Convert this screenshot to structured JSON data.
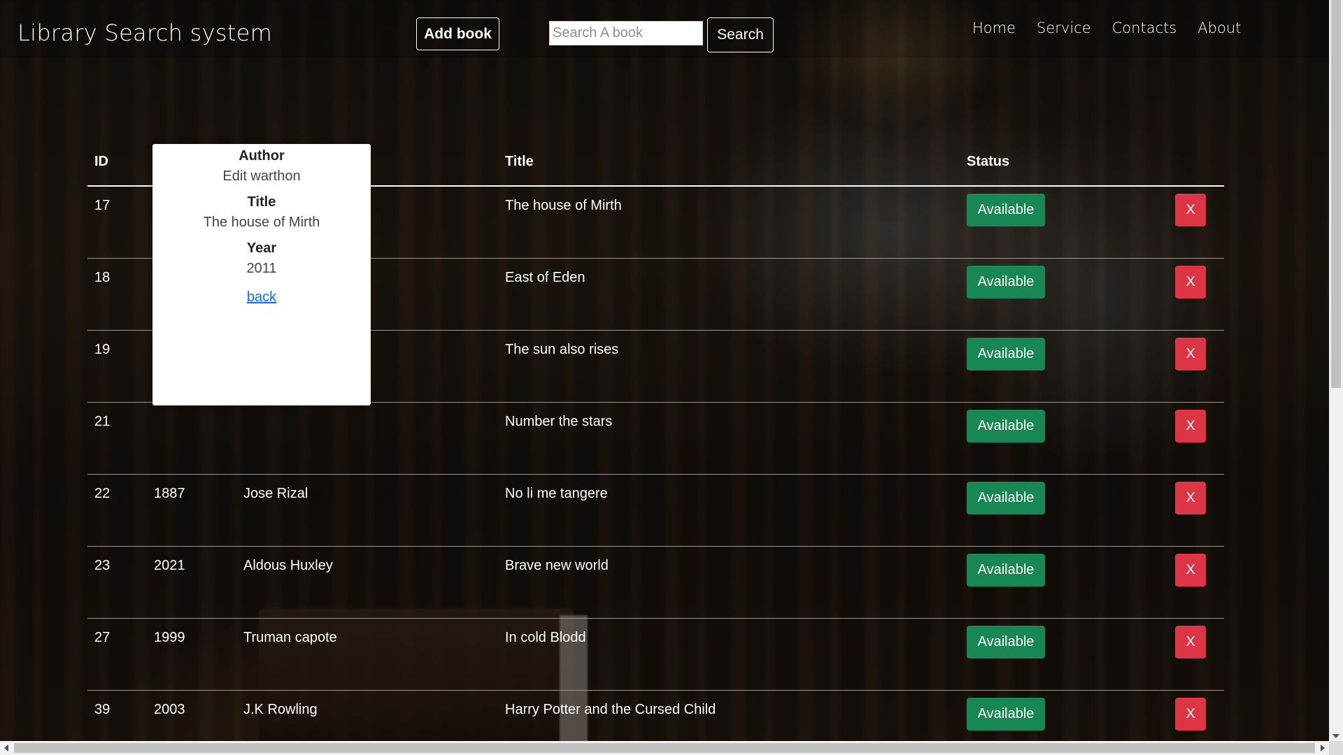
{
  "header": {
    "brand": "Library Search system",
    "add_book_label": "Add book",
    "search_placeholder": "Search A book",
    "search_label": "Search",
    "nav": [
      "Home",
      "Service",
      "Contacts",
      "About"
    ]
  },
  "table": {
    "columns": [
      "ID",
      "",
      "",
      "Title",
      "Status",
      ""
    ],
    "rows": [
      {
        "id": "17",
        "year": "",
        "author": "",
        "title": "The house of Mirth",
        "status": "Available",
        "delete": "X"
      },
      {
        "id": "18",
        "year": "",
        "author": "",
        "title": "East of Eden",
        "status": "Available",
        "delete": "X"
      },
      {
        "id": "19",
        "year": "",
        "author": "",
        "title": "The sun also rises",
        "status": "Available",
        "delete": "X"
      },
      {
        "id": "21",
        "year": "",
        "author": "",
        "title": "Number the stars",
        "status": "Available",
        "delete": "X"
      },
      {
        "id": "22",
        "year": "1887",
        "author": "Jose Rizal",
        "title": "No li me tangere",
        "status": "Available",
        "delete": "X"
      },
      {
        "id": "23",
        "year": "2021",
        "author": "Aldous Huxley",
        "title": "Brave new world",
        "status": "Available",
        "delete": "X"
      },
      {
        "id": "27",
        "year": "1999",
        "author": "Truman capote",
        "title": "In cold Blodd",
        "status": "Available",
        "delete": "X"
      },
      {
        "id": "39",
        "year": "2003",
        "author": "J.K Rowling",
        "title": "Harry Potter and the Cursed Child",
        "status": "Available",
        "delete": "X"
      }
    ]
  },
  "popup": {
    "author_label": "Author",
    "author_value": "Edit warthon",
    "title_label": "Title",
    "title_value": "The house of Mirth",
    "year_label": "Year",
    "year_value": "2011",
    "back_label": "back"
  },
  "colors": {
    "status_green": "#198754",
    "delete_red": "#dc3545",
    "link_blue": "#0d6efd"
  }
}
